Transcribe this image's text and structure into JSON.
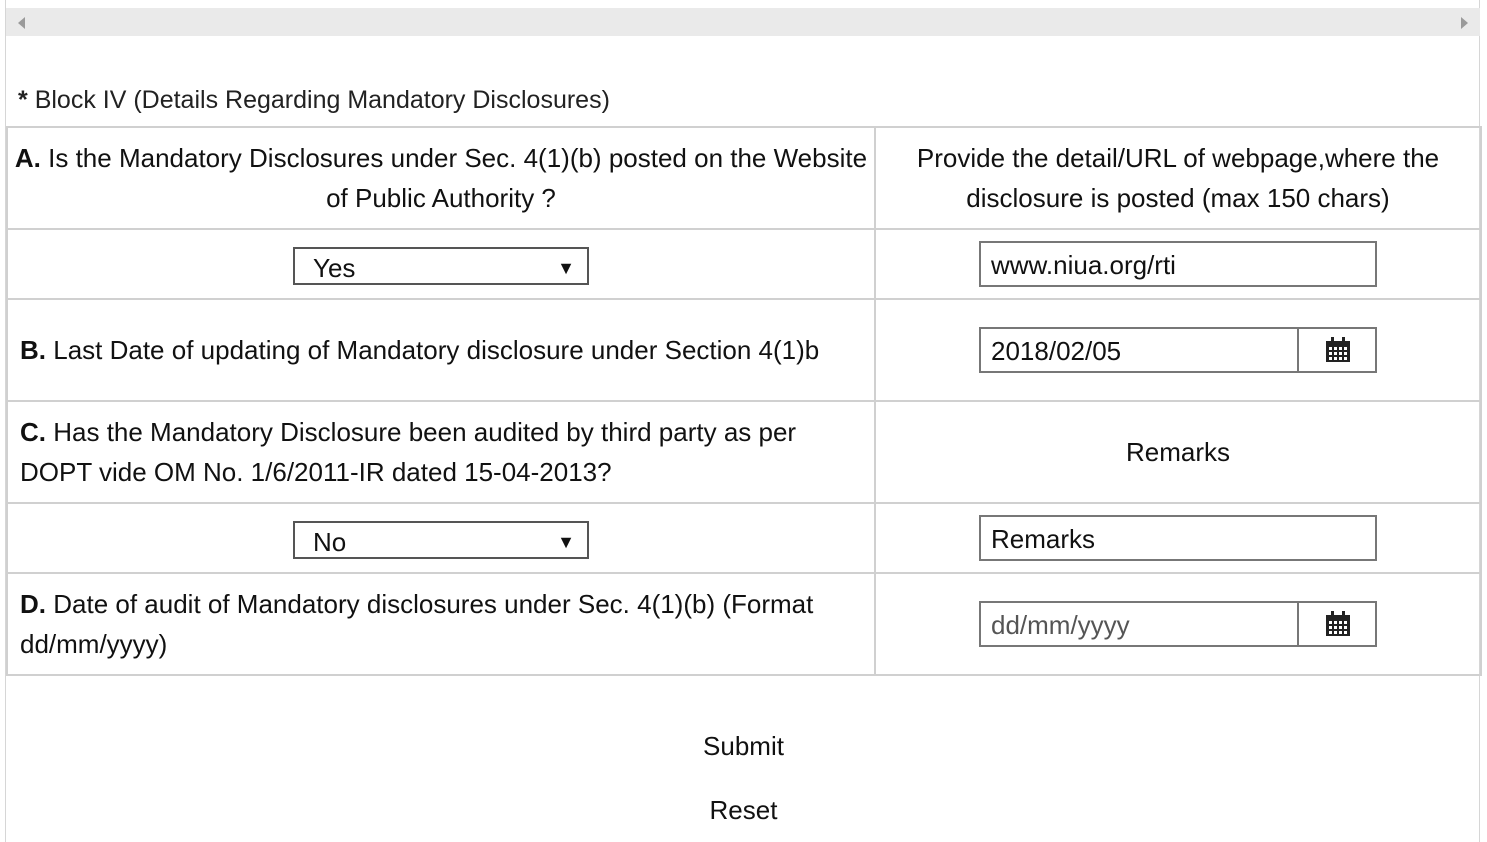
{
  "block": {
    "star": "*",
    "title": "Block IV (Details Regarding Mandatory Disclosures)"
  },
  "rowA": {
    "letter": "A.",
    "question": "Is the Mandatory Disclosures under Sec. 4(1)(b) posted on the Website of Public Authority ?",
    "right_header": "Provide the detail/URL of webpage,where the disclosure is posted (max 150 chars)",
    "select_value": "Yes",
    "url_value": "www.niua.org/rti"
  },
  "rowB": {
    "letter": "B.",
    "question": "Last Date of updating of Mandatory disclosure under Section 4(1)b",
    "date_value": "2018/02/05"
  },
  "rowC": {
    "letter": "C.",
    "question": "Has the Mandatory Disclosure been audited by third party as per DOPT vide OM No. 1/6/2011-IR dated 15-04-2013?",
    "right_header": "Remarks",
    "select_value": "No",
    "remarks_value": "Remarks"
  },
  "rowD": {
    "letter": "D.",
    "question": "Date of audit of Mandatory disclosures under Sec. 4(1)(b) (Format dd/mm/yyyy)",
    "date_placeholder": "dd/mm/yyyy"
  },
  "caret": "▼",
  "buttons": {
    "submit": "Submit",
    "reset": "Reset"
  },
  "icons": {
    "calendar": "calendar-icon",
    "scroll_left": "scroll-left-arrow-icon",
    "scroll_right": "scroll-right-arrow-icon"
  }
}
